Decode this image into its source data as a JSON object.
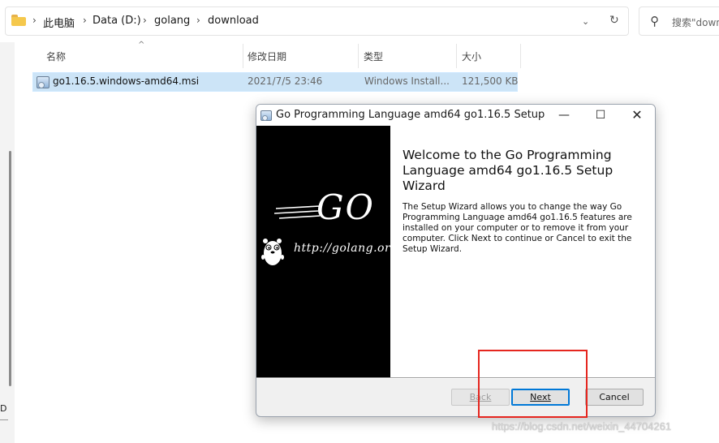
{
  "explorer": {
    "breadcrumb": [
      "此电脑",
      "Data (D:)",
      "golang",
      "download"
    ],
    "search_placeholder": "搜索\"down",
    "left_letter": "D",
    "columns": {
      "name": "名称",
      "modified": "修改日期",
      "type": "类型",
      "size": "大小"
    },
    "files": [
      {
        "name": "go1.16.5.windows-amd64.msi",
        "modified": "2021/7/5 23:46",
        "type": "Windows Install...",
        "size": "121,500 KB"
      }
    ]
  },
  "dialog": {
    "title": "Go Programming Language amd64 go1.16.5 Setup",
    "banner": {
      "logo_text": "GO",
      "url": "http://golang.org"
    },
    "welcome_heading": "Welcome to the Go Programming Language amd64 go1.16.5 Setup Wizard",
    "description": "The Setup Wizard allows you to change the way Go Programming Language amd64 go1.16.5 features are installed on your computer or to remove it from your computer. Click Next to continue or Cancel to exit the Setup Wizard.",
    "buttons": {
      "back": "Back",
      "next": "Next",
      "cancel": "Cancel"
    }
  },
  "watermark": "https://blog.csdn.net/weixin_44704261",
  "colors": {
    "selection": "#cce4f7",
    "annotation": "#e5261f",
    "default_button_border": "#0078d7"
  },
  "icons": [
    "folder-icon",
    "chevron-right-icon",
    "chevron-down-icon",
    "refresh-icon",
    "search-icon",
    "msi-installer-icon",
    "minimize-icon",
    "maximize-icon",
    "close-icon",
    "gopher-mascot"
  ]
}
